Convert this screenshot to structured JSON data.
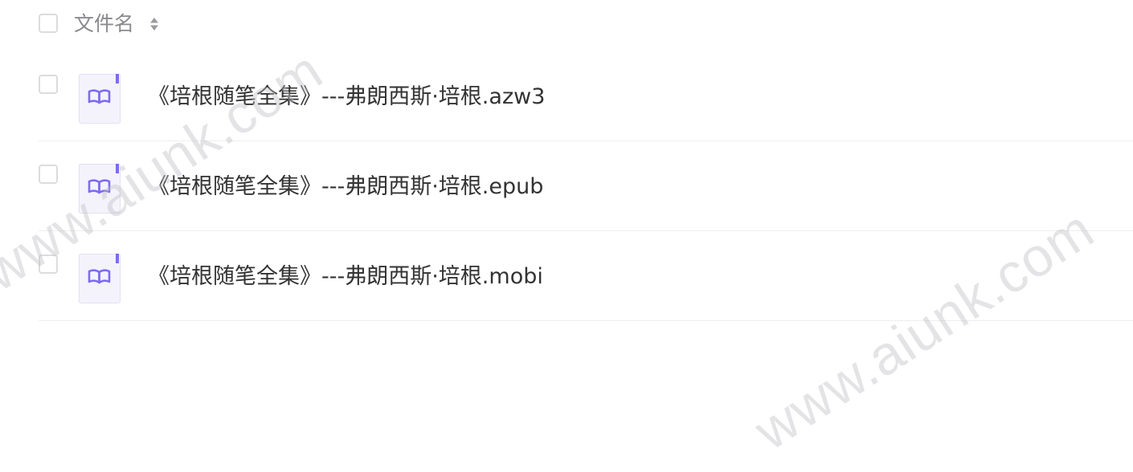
{
  "header": {
    "column_label": "文件名",
    "sort_icon": "sort-up-down-icon"
  },
  "files": [
    {
      "name": "《培根随笔全集》---弗朗西斯·培根.azw3",
      "icon": "book-icon"
    },
    {
      "name": "《培根随笔全集》---弗朗西斯·培根.epub",
      "icon": "book-icon"
    },
    {
      "name": "《培根随笔全集》---弗朗西斯·培根.mobi",
      "icon": "book-icon"
    }
  ],
  "watermark": {
    "text": "www.aiunk.com"
  },
  "colors": {
    "icon_accent": "#7b6cf0",
    "icon_bg": "#f4f3fb",
    "checkbox_border": "#dcdcdf",
    "divider": "#eeeef0"
  }
}
